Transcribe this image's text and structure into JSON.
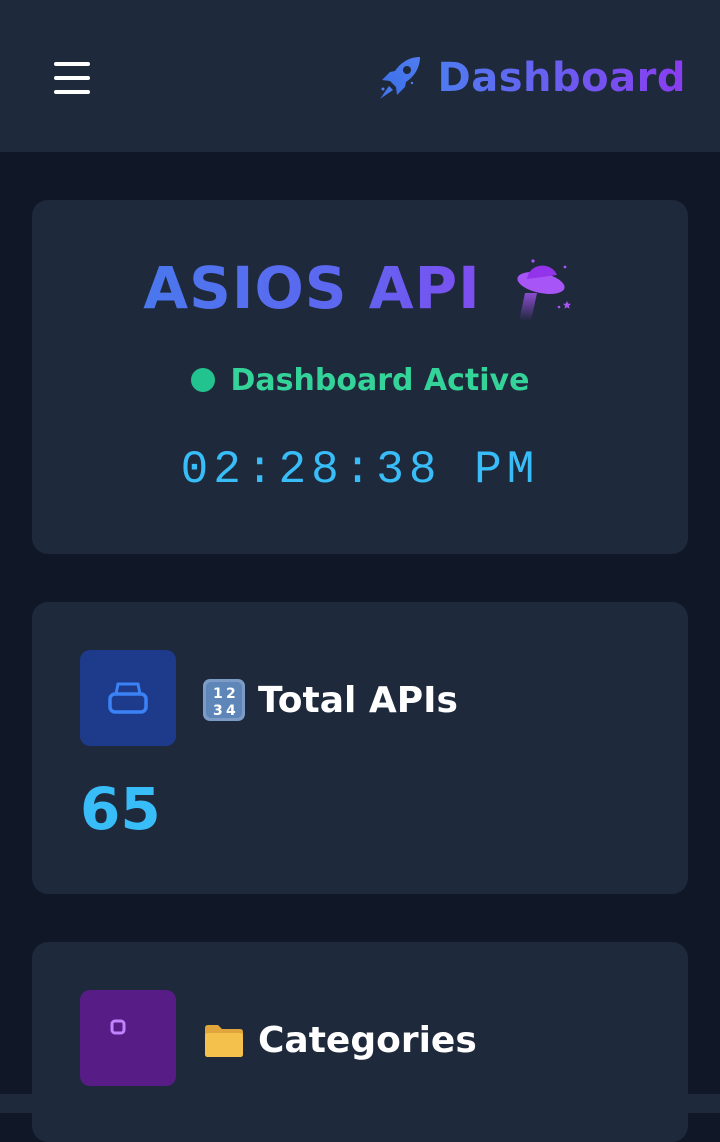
{
  "header": {
    "menu_icon": "hamburger-menu-icon",
    "brand_icon": "rocket-icon",
    "title": "Dashboard",
    "accent_color": "#6366f1"
  },
  "hero": {
    "title": "ASIOS API",
    "title_icon": "ufo-icon",
    "status_text": "Dashboard Active",
    "status_color": "#34d399",
    "clock": "02:28:38 PM"
  },
  "stats": [
    {
      "icon": "basket-icon",
      "emoji": "input-numbers-emoji",
      "label": "Total APIs",
      "value": "65"
    },
    {
      "icon": "tag-icon",
      "emoji": "folder-emoji",
      "label": "Categories",
      "value": ""
    }
  ]
}
